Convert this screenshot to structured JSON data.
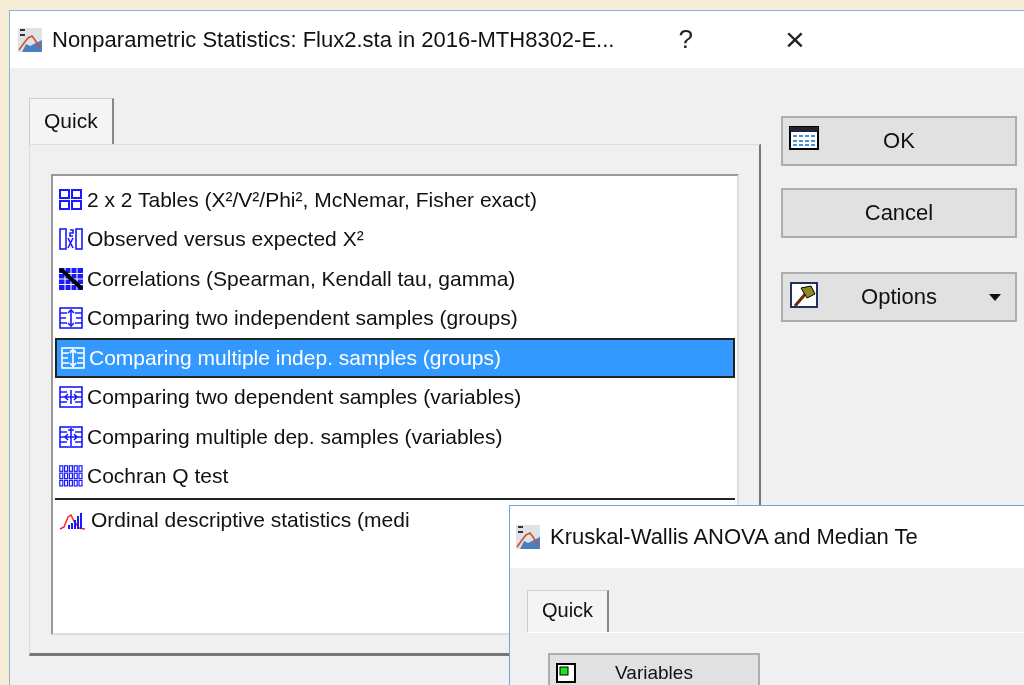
{
  "window": {
    "title": "Nonparametric Statistics: Flux2.sta in 2016-MTH8302-E...",
    "help": "?",
    "close": "×"
  },
  "tabs": [
    {
      "label": "Quick",
      "selected": true
    }
  ],
  "procedures": [
    {
      "kind": "tables",
      "label": "2 x 2 Tables (X²/V²/Phi², McNemar, Fisher exact)",
      "selected": false,
      "separator_before": false
    },
    {
      "kind": "observed",
      "label": "Observed versus expected X²",
      "selected": false,
      "separator_before": false
    },
    {
      "kind": "correlation",
      "label": "Correlations (Spearman, Kendall tau, gamma)",
      "selected": false,
      "separator_before": false
    },
    {
      "kind": "two-indep",
      "label": "Comparing two independent samples (groups)",
      "selected": false,
      "separator_before": false
    },
    {
      "kind": "multi-indep",
      "label": "Comparing multiple indep. samples (groups)",
      "selected": true,
      "separator_before": false
    },
    {
      "kind": "two-dep",
      "label": "Comparing two dependent samples (variables)",
      "selected": false,
      "separator_before": false
    },
    {
      "kind": "multi-dep",
      "label": "Comparing multiple dep. samples (variables)",
      "selected": false,
      "separator_before": false
    },
    {
      "kind": "binary",
      "label": "Cochran Q test",
      "selected": false,
      "separator_before": false
    },
    {
      "kind": "ordinal",
      "label": "Ordinal descriptive statistics (medi",
      "selected": false,
      "separator_before": true
    }
  ],
  "buttons": [
    {
      "kind": "ok",
      "label": "OK"
    },
    {
      "kind": "cancel",
      "label": "Cancel"
    },
    {
      "kind": "options",
      "label": "Options"
    }
  ],
  "subwindow": {
    "title": "Kruskal-Wallis ANOVA and Median Te",
    "tabs": [
      {
        "label": "Quick",
        "selected": true
      }
    ],
    "buttons": [
      {
        "label": "Variables"
      }
    ]
  }
}
